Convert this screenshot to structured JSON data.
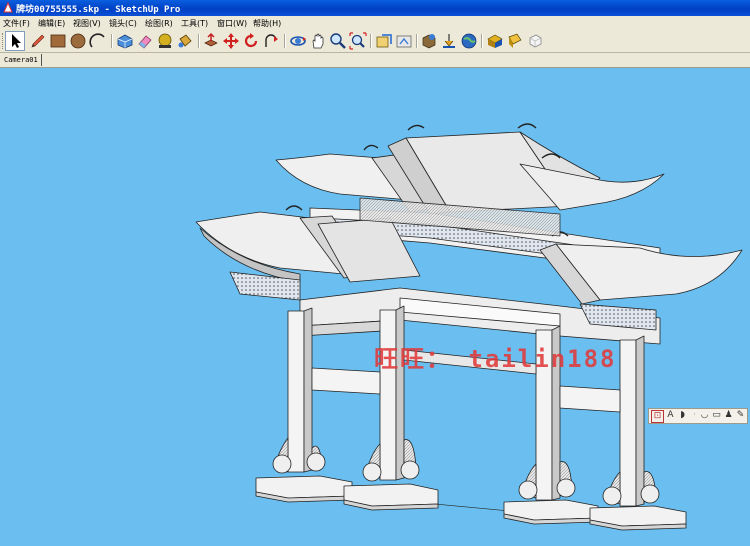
{
  "window": {
    "title": "牌坊00755555.skp - SketchUp Pro"
  },
  "menubar": [
    {
      "label": "文件(F)"
    },
    {
      "label": "编辑(E)"
    },
    {
      "label": "视图(V)"
    },
    {
      "label": "镜头(C)"
    },
    {
      "label": "绘图(R)"
    },
    {
      "label": "工具(T)"
    },
    {
      "label": "窗口(W)"
    },
    {
      "label": "帮助(H)"
    }
  ],
  "toolbar": {
    "tools": [
      "select-icon",
      "pencil-icon",
      "rectangle-icon",
      "circle-icon",
      "arc-icon",
      "make-component-icon",
      "eraser-icon",
      "tape-measure-icon",
      "paint-bucket-icon",
      "push-pull-icon",
      "move-icon",
      "rotate-icon",
      "follow-me-icon",
      "orbit-icon",
      "pan-icon",
      "zoom-icon",
      "zoom-extents-icon",
      "3d-warehouse-icon",
      "share-model-icon",
      "get-models-icon",
      "place-model-icon",
      "google-earth-icon",
      "extension-warehouse-icon",
      "layout-icon",
      "style-builder-icon"
    ],
    "active_tool": "select-icon"
  },
  "scene_tabs": [
    {
      "label": "Camera01"
    }
  ],
  "watermark": "旺旺： tailin188",
  "colors": {
    "background": "#6bbff0",
    "watermark": "#e13a3a",
    "titlebar": "#0a4fd6"
  },
  "floating_toolbar": {
    "items": [
      "section-plane-icon",
      "text-icon",
      "dimension-icon",
      "separator-icon",
      "protractor-icon",
      "axes-icon",
      "walk-icon",
      "position-camera-icon"
    ]
  }
}
